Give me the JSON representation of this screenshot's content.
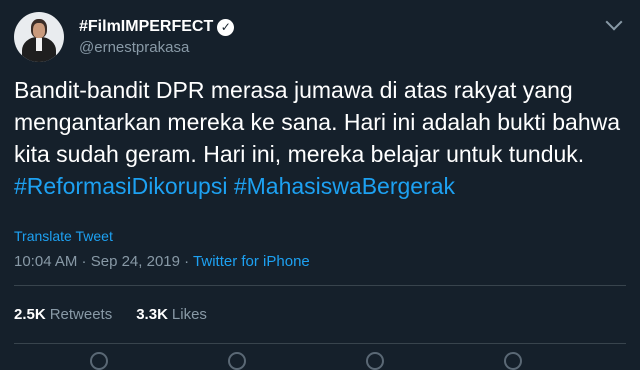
{
  "colors": {
    "background": "#15202b",
    "text": "#ffffff",
    "muted": "#8899a6",
    "link": "#1da1f2"
  },
  "author": {
    "display_name": "#FilmIMPERFECT",
    "handle": "@ernestprakasa",
    "verified_icon": "verified-badge-icon",
    "avatar_icon": "avatar-photo"
  },
  "tweet": {
    "text_segments": [
      {
        "text": "Bandit-bandit DPR merasa jumawa di atas rakyat yang mengantarkan mereka ke sana. Hari ini adalah bukti bahwa kita sudah geram. Hari ini, mereka belajar untuk tunduk. ",
        "type": "text"
      },
      {
        "text": "#ReformasiDikorupsi",
        "type": "hashtag"
      },
      {
        "text": " ",
        "type": "text"
      },
      {
        "text": "#MahasiswaBergerak",
        "type": "hashtag"
      }
    ],
    "translate_label": "Translate Tweet",
    "time": "10:04 AM",
    "separator": " · ",
    "date": "Sep 24, 2019",
    "source": "Twitter for iPhone"
  },
  "stats": {
    "retweets_count": "2.5K",
    "retweets_label": "Retweets",
    "likes_count": "3.3K",
    "likes_label": "Likes"
  },
  "menu_icon": "chevron-down-icon"
}
